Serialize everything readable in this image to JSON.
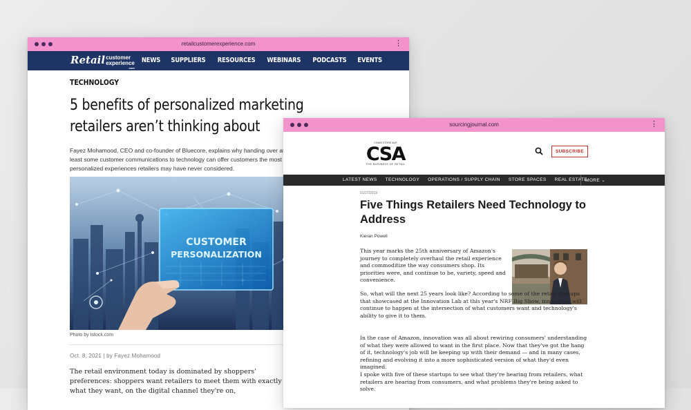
{
  "left_window": {
    "url": "retailcustomerexperience.com",
    "logo": {
      "retail": "Retail",
      "customer": "customer",
      "experience": "experience",
      "com": ".com"
    },
    "nav": [
      "NEWS",
      "SUPPLIERS",
      "RESOURCES",
      "WEBINARS",
      "PODCASTS",
      "EVENTS"
    ],
    "category": "TECHNOLOGY",
    "title": "5 benefits of personalized marketing retailers aren’t thinking about",
    "dek": "Fayez Mohamood, CEO and co-founder of Bluecore, explains why handing over at least some customer communications to technology can offer customers the most personalized experiences retailers may have never considered.",
    "image_text": [
      "CUSTOMER",
      "PERSONALIZATION"
    ],
    "photo_credit": "Photo by Istock.com",
    "byline": "Oct. 8, 2021 | by Fayez Mohamood",
    "body": "The retail environment today is dominated by shoppers' preferences: shoppers want retailers to meet them with exactly what they want, on the digital channel they're on,"
  },
  "right_window": {
    "url": "sourcingjournal.com",
    "logo": {
      "top": "CHAIN STORE AGE",
      "letters": "CSA",
      "tagline": "THE BUSINESS OF RETAIL"
    },
    "subscribe": "SUBSCRIBE",
    "nav": [
      "LATEST NEWS",
      "TECHNOLOGY",
      "OPERATIONS / SUPPLY CHAIN",
      "STORE SPACES",
      "REAL ESTATE"
    ],
    "nav_more": "MORE",
    "date": "01/27/2019",
    "title": "Five Things Retailers Need Technology to Address",
    "author": "Kieran Powell",
    "paragraphs": [
      "This year marks the 25th anniversary of Amazon's journey to completely overhaul the retail experience and commoditize the way consumers shop. Its priorities were, and continue to be, variety, speed and convenience.",
      "So, what will the next 25 years look like? According to some of the retail startups that showcased at the Innovation Lab at this year's NRF Big Show, innovation will continue to happen at the intersection of what customers want and technology's ability to give it to them.",
      "In the case of Amazon, innovation was all about rewiring consumers' understanding of what they were allowed to want in the first place. Now that they've got the hang of it, technology's job will be keeping up with their demand — and in many cases, refining and evolving it into a more sophisticated version of what they'd even imagined.",
      "I spoke with five of these startups to see what they're hearing from retailers, what retailers are hearing from consumers, and what problems they're being asked to solve."
    ]
  },
  "colors": {
    "chrome": "#f293cc",
    "rce_nav": "#1e3464",
    "csa_nav": "#2a2a2a",
    "subscribe": "#c0302a"
  },
  "icons": [
    "window-dots-icon",
    "kebab-menu-icon",
    "search-icon",
    "chevron-down-icon"
  ]
}
